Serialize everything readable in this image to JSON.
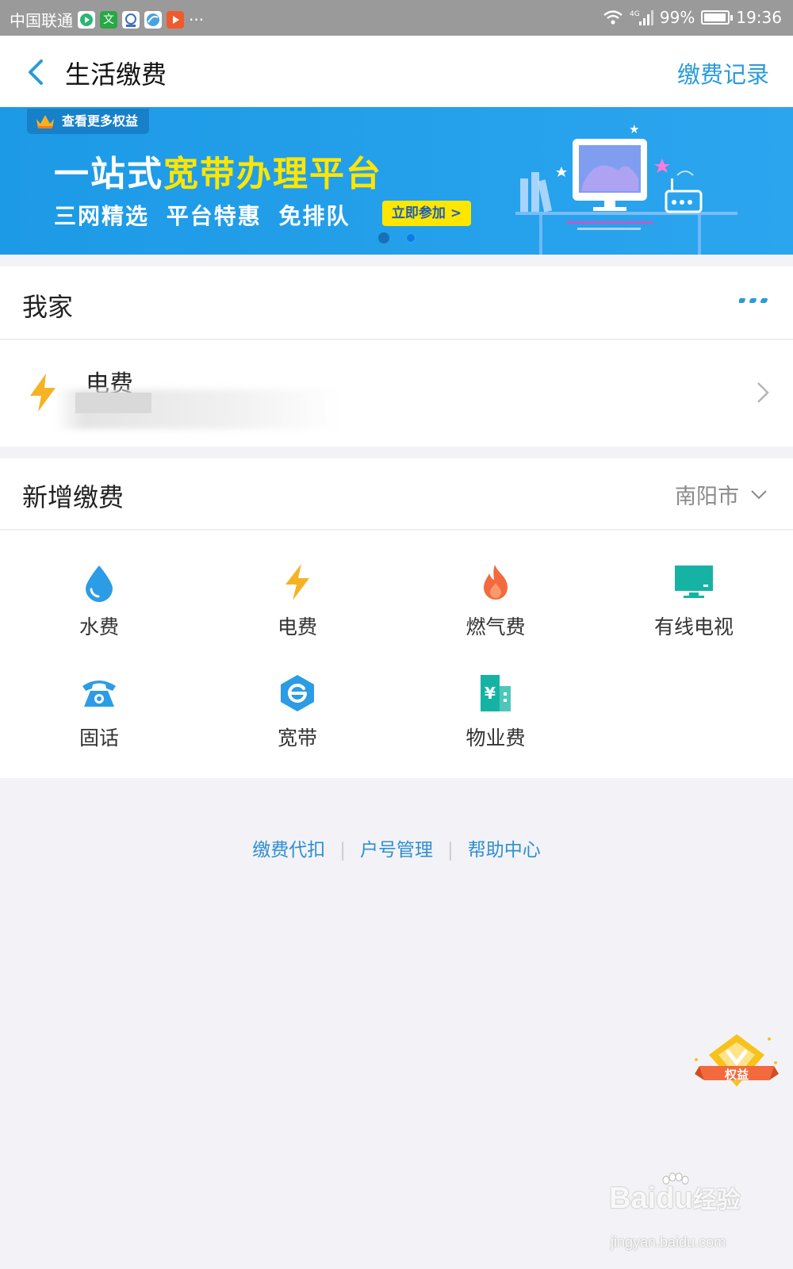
{
  "status_bar": {
    "carrier": "中国联通",
    "more": "···",
    "network": "4G",
    "battery": "99%",
    "time": "19:36",
    "battery_level": 0.99
  },
  "header": {
    "title": "生活缴费",
    "record_link": "缴费记录"
  },
  "banner": {
    "tag": "查看更多权益",
    "title_prefix": "一站式",
    "title_highlight": "宽带办理平台",
    "subtitle": "三网精选 平台特惠 免排队",
    "cta": "立即参加 >",
    "page_count": 2,
    "active_page": 2
  },
  "my_home": {
    "title": "我家",
    "bill_name": "电费"
  },
  "new_payment": {
    "title": "新增缴费",
    "city": "南阳市",
    "items": [
      {
        "label": "水费",
        "icon": "water-drop-icon",
        "color": "#2b9ce5"
      },
      {
        "label": "电费",
        "icon": "lightning-icon",
        "color": "#f5b223"
      },
      {
        "label": "燃气费",
        "icon": "flame-icon",
        "color": "#f26a3d"
      },
      {
        "label": "有线电视",
        "icon": "tv-icon",
        "color": "#16b3a4"
      },
      {
        "label": "固话",
        "icon": "telephone-icon",
        "color": "#2b9ce5"
      },
      {
        "label": "宽带",
        "icon": "broadband-icon",
        "color": "#2b9ce5"
      },
      {
        "label": "物业费",
        "icon": "building-icon",
        "color": "#16b3a4"
      }
    ]
  },
  "footer": {
    "links": [
      "缴费代扣",
      "户号管理",
      "帮助中心"
    ]
  },
  "vip_badge": {
    "label": "权益"
  },
  "watermark": {
    "brand": "Bai",
    "brand2": "du",
    "cn": "经验",
    "url": "jingyan.baidu.com"
  },
  "colors": {
    "accent": "#2a9bd8",
    "banner": "#1d9ae6",
    "highlight": "#ffe600"
  }
}
